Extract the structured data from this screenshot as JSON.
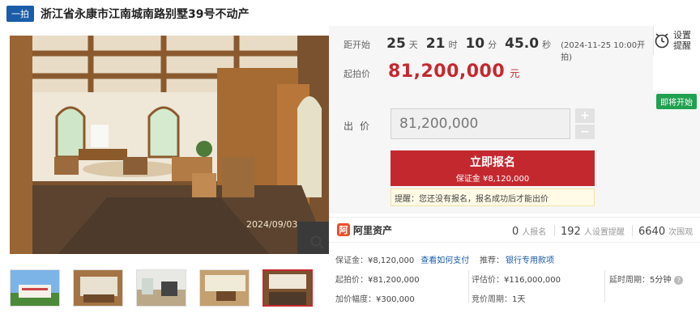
{
  "header": {
    "tag": "一拍",
    "title": "浙江省永康市江南城南路别墅39号不动产"
  },
  "countdown": {
    "label": "距开始",
    "days": "25",
    "days_unit": "天",
    "hours": "21",
    "hours_unit": "时",
    "minutes": "10",
    "minutes_unit": "分",
    "seconds": "45.0",
    "seconds_unit": "秒",
    "start_note": "(2024-11-25 10:00开拍)"
  },
  "remind": {
    "label_line1": "设置",
    "label_line2": "提醒"
  },
  "start_price": {
    "label": "起拍价",
    "value": "81,200,000",
    "unit": "元"
  },
  "status_badge": "即将开始",
  "bid": {
    "label": "出价",
    "value": "81,200,000",
    "plus": "+",
    "minus": "−",
    "signup_label": "立即报名",
    "deposit_label": "保证金 ¥8,120,000",
    "notice": "提醒：您还没有报名，报名成功后才能出价"
  },
  "image": {
    "watermark": "2024/09/03"
  },
  "stats": {
    "org_icon": "阿",
    "org_name": "阿里资产",
    "signups_num": "0",
    "signups_label": "人报名",
    "reminders_num": "192",
    "reminders_label": "人设置提醒",
    "views_num": "6640",
    "views_label": "次围观"
  },
  "info": {
    "deposit_label": "保证金：",
    "deposit_value": "¥8,120,000",
    "deposit_link": "查看如何支付",
    "recommend_label": "推荐：",
    "recommend_value": "银行专用款项",
    "start_label": "起拍价：",
    "start_value": "¥81,200,000",
    "appraisal_label": "评估价：",
    "appraisal_value": "¥116,000,000",
    "extend_label": "延时周期：",
    "extend_value": "5分钟",
    "increment_label": "加价幅度：",
    "increment_value": "¥300,000",
    "cycle_label": "竞价周期：",
    "cycle_value": "1天"
  },
  "colors": {
    "accent_red": "#c4282f",
    "tag_blue": "#1a5ca8",
    "badge_green": "#20a050"
  },
  "icons": [
    "alarm-clock-icon",
    "zoom-icon",
    "help-icon",
    "ali-logo-icon"
  ]
}
